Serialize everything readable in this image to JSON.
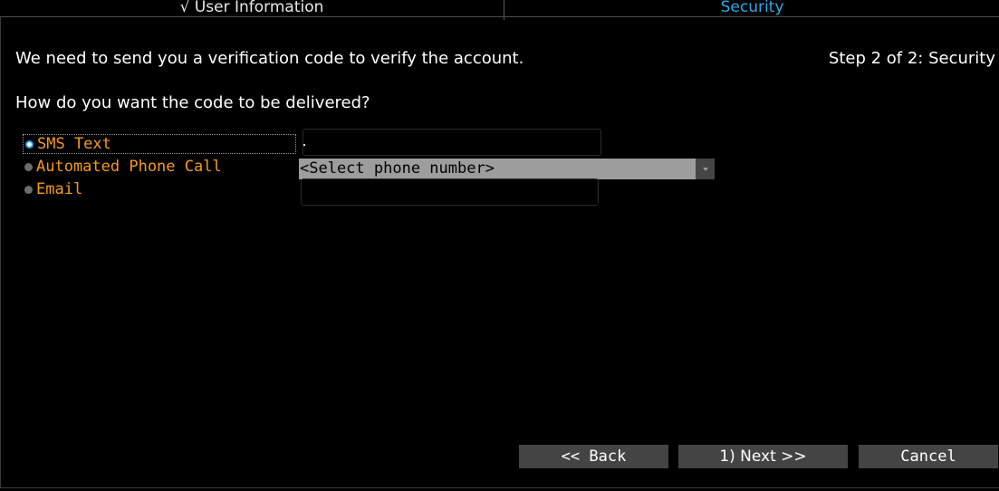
{
  "tabs": [
    {
      "label": "√ User Information",
      "state": "completed"
    },
    {
      "label": "Security",
      "state": "active"
    }
  ],
  "header": {
    "intro": "We need to send you a verification code to verify the account.",
    "step": "Step 2 of 2: Security"
  },
  "question": "How do you want the code to be delivered?",
  "delivery_options": [
    {
      "label": "SMS Text",
      "selected": true
    },
    {
      "label": "Automated Phone Call",
      "selected": false
    },
    {
      "label": "Email",
      "selected": false
    }
  ],
  "fields": {
    "sms_value": "",
    "phone_select": "<Select phone number>",
    "email_value": ""
  },
  "buttons": {
    "back": "<< Back",
    "next": "1) Next >>",
    "cancel": "Cancel"
  },
  "colors": {
    "option_text": "#f39a1c",
    "active_tab": "#29a9e8",
    "radio_selected": "#2a9ff0",
    "button_bg": "#444444",
    "select_bg": "#9d9d9d"
  }
}
